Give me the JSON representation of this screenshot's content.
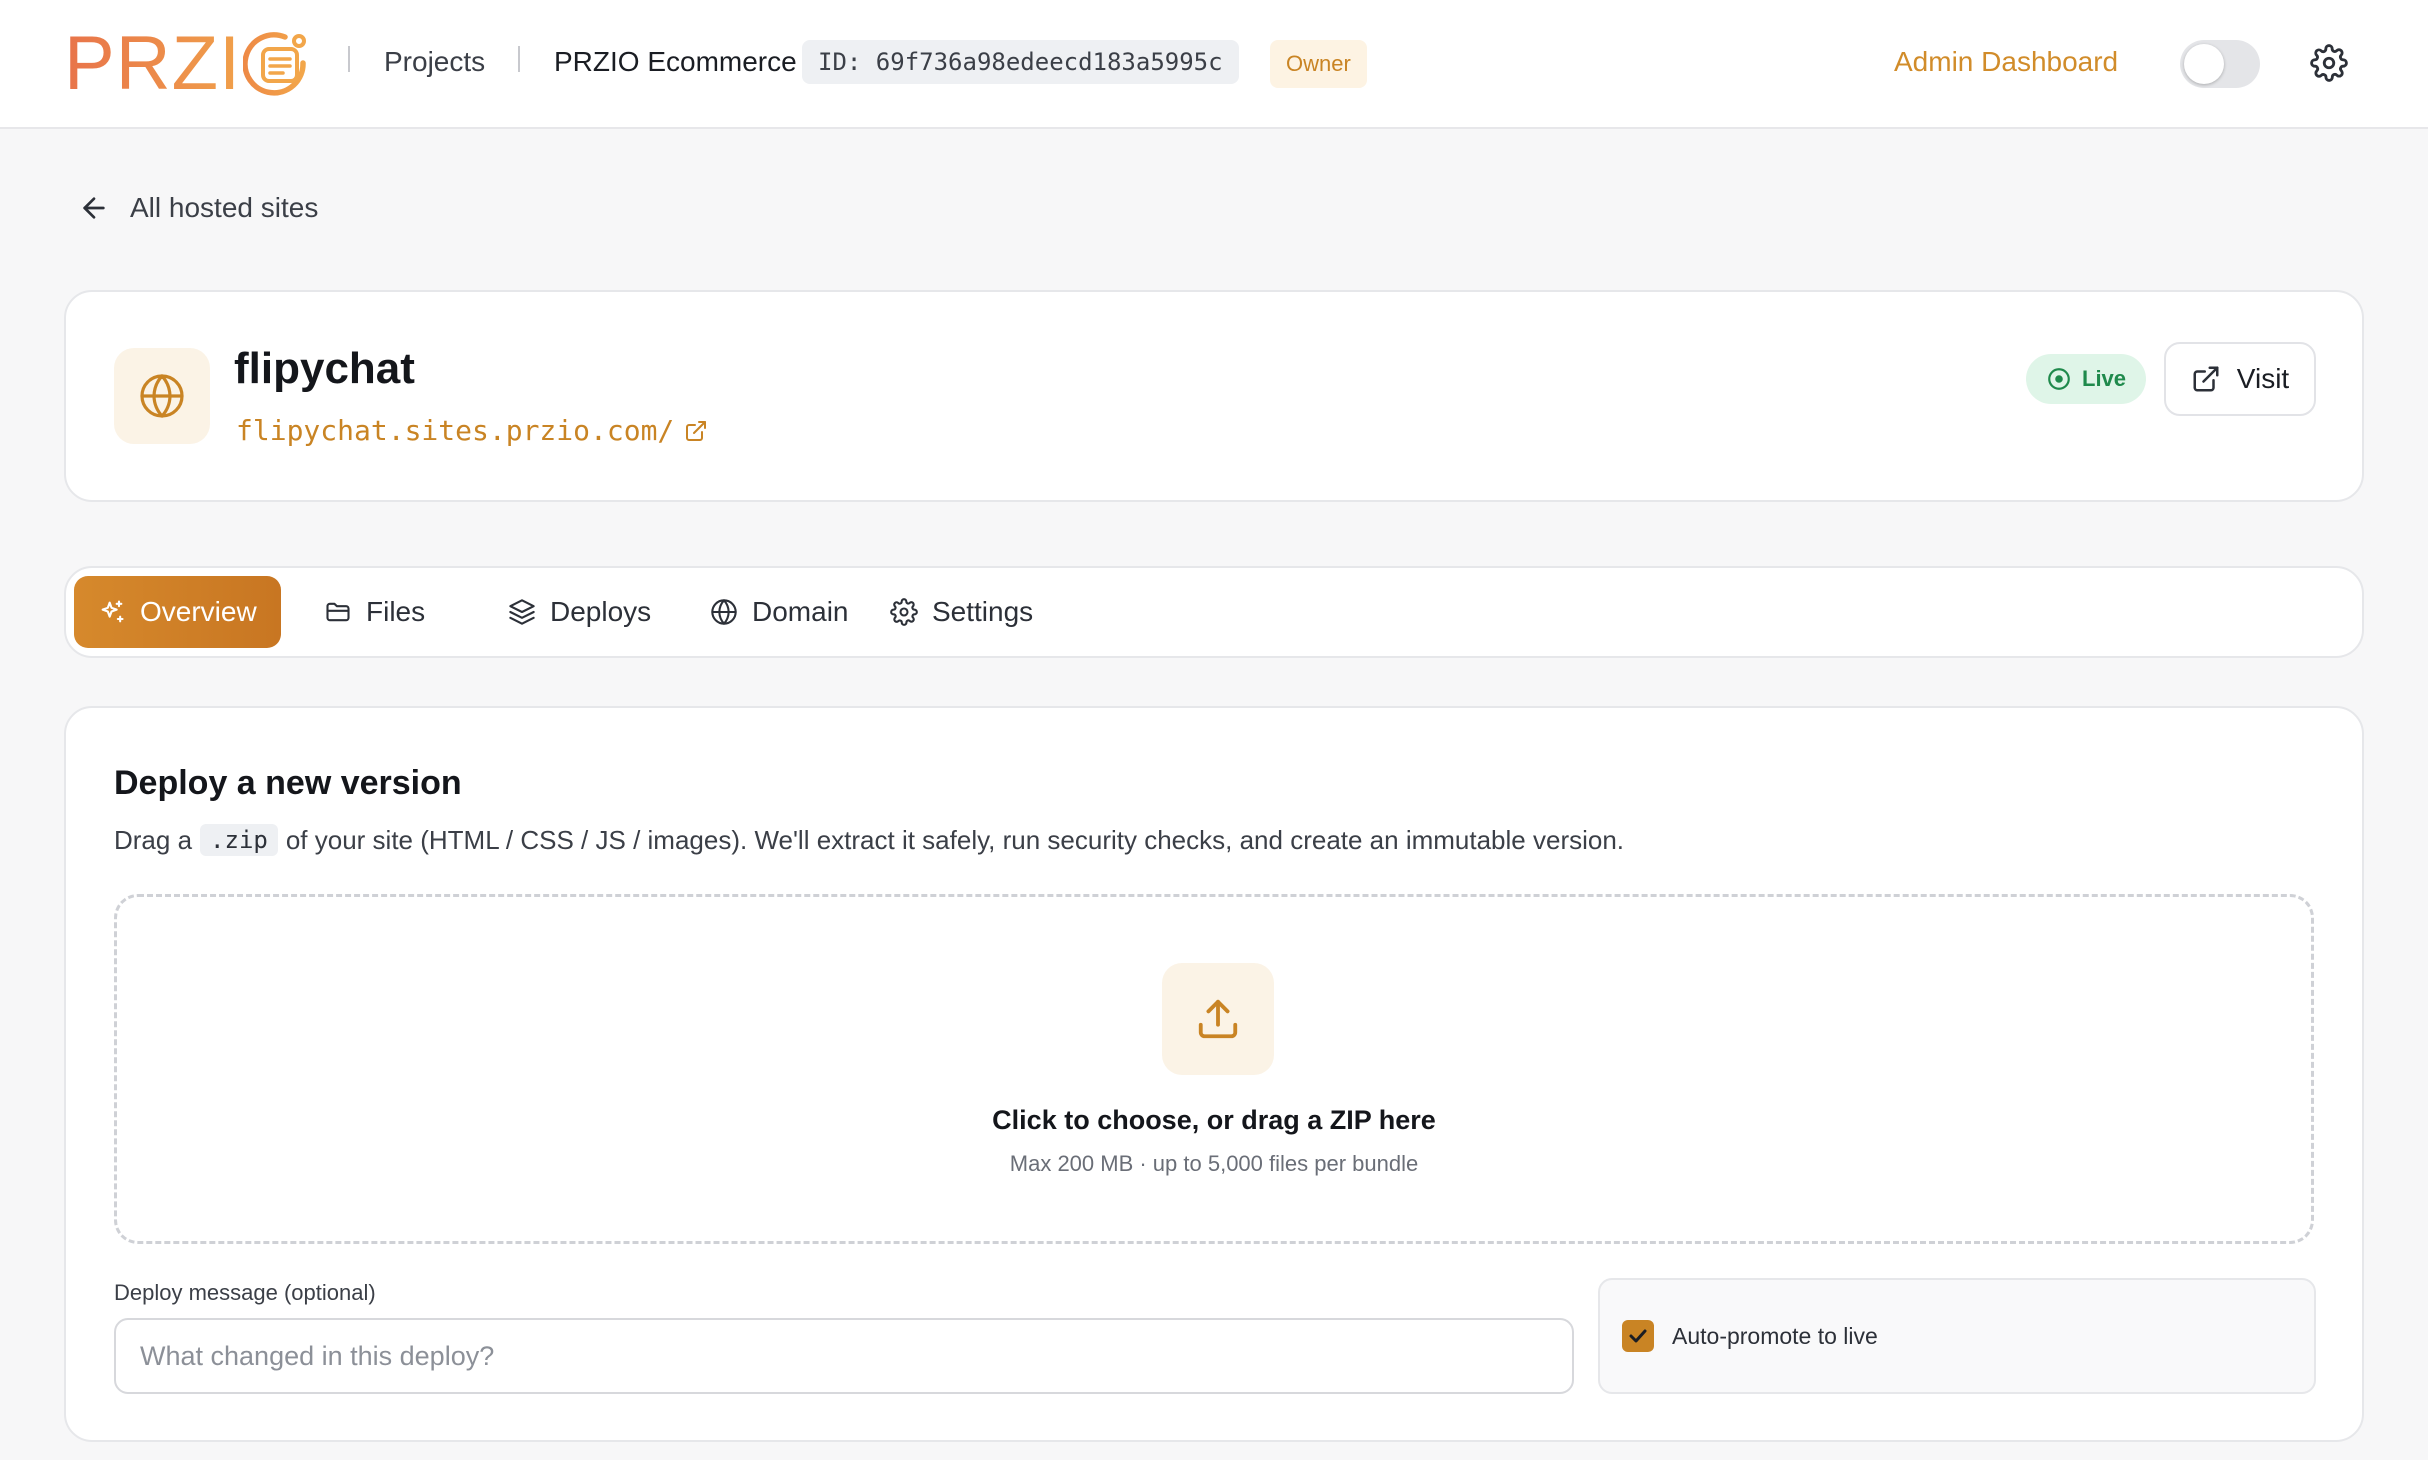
{
  "brand": {
    "logo_text": "PRZI",
    "accent": "#d18c2a",
    "logo_gradient": [
      "#e8734a",
      "#f0a04a"
    ]
  },
  "header": {
    "projects_label": "Projects",
    "project_name": "PRZIO Ecommerce",
    "project_id": "ID: 69f736a98edeecd183a5995c",
    "role_badge": "Owner",
    "admin_link": "Admin Dashboard",
    "theme_toggle_on": false
  },
  "back_link": {
    "label": "All hosted sites"
  },
  "site": {
    "name": "flipychat",
    "url": "flipychat.sites.przio.com/",
    "status": "Live",
    "status_color": "#1f8a4c",
    "visit_label": "Visit"
  },
  "tabs": [
    {
      "label": "Overview",
      "icon": "sparkles-icon",
      "active": true
    },
    {
      "label": "Files",
      "icon": "folder-icon",
      "active": false
    },
    {
      "label": "Deploys",
      "icon": "layers-icon",
      "active": false
    },
    {
      "label": "Domain",
      "icon": "globe-icon",
      "active": false
    },
    {
      "label": "Settings",
      "icon": "gear-icon",
      "active": false
    }
  ],
  "deploy": {
    "title": "Deploy a new version",
    "desc_before": "Drag a",
    "desc_code": ".zip",
    "desc_after": "of your site (HTML / CSS / JS / images). We'll extract it safely, run security checks, and create an immutable version.",
    "drop_primary": "Click to choose, or drag a ZIP here",
    "drop_secondary": "Max 200 MB · up to 5,000 files per bundle",
    "message_label": "Deploy message (optional)",
    "message_placeholder": "What changed in this deploy?",
    "message_value": "",
    "auto_promote_label": "Auto-promote to live",
    "auto_promote_checked": true
  }
}
